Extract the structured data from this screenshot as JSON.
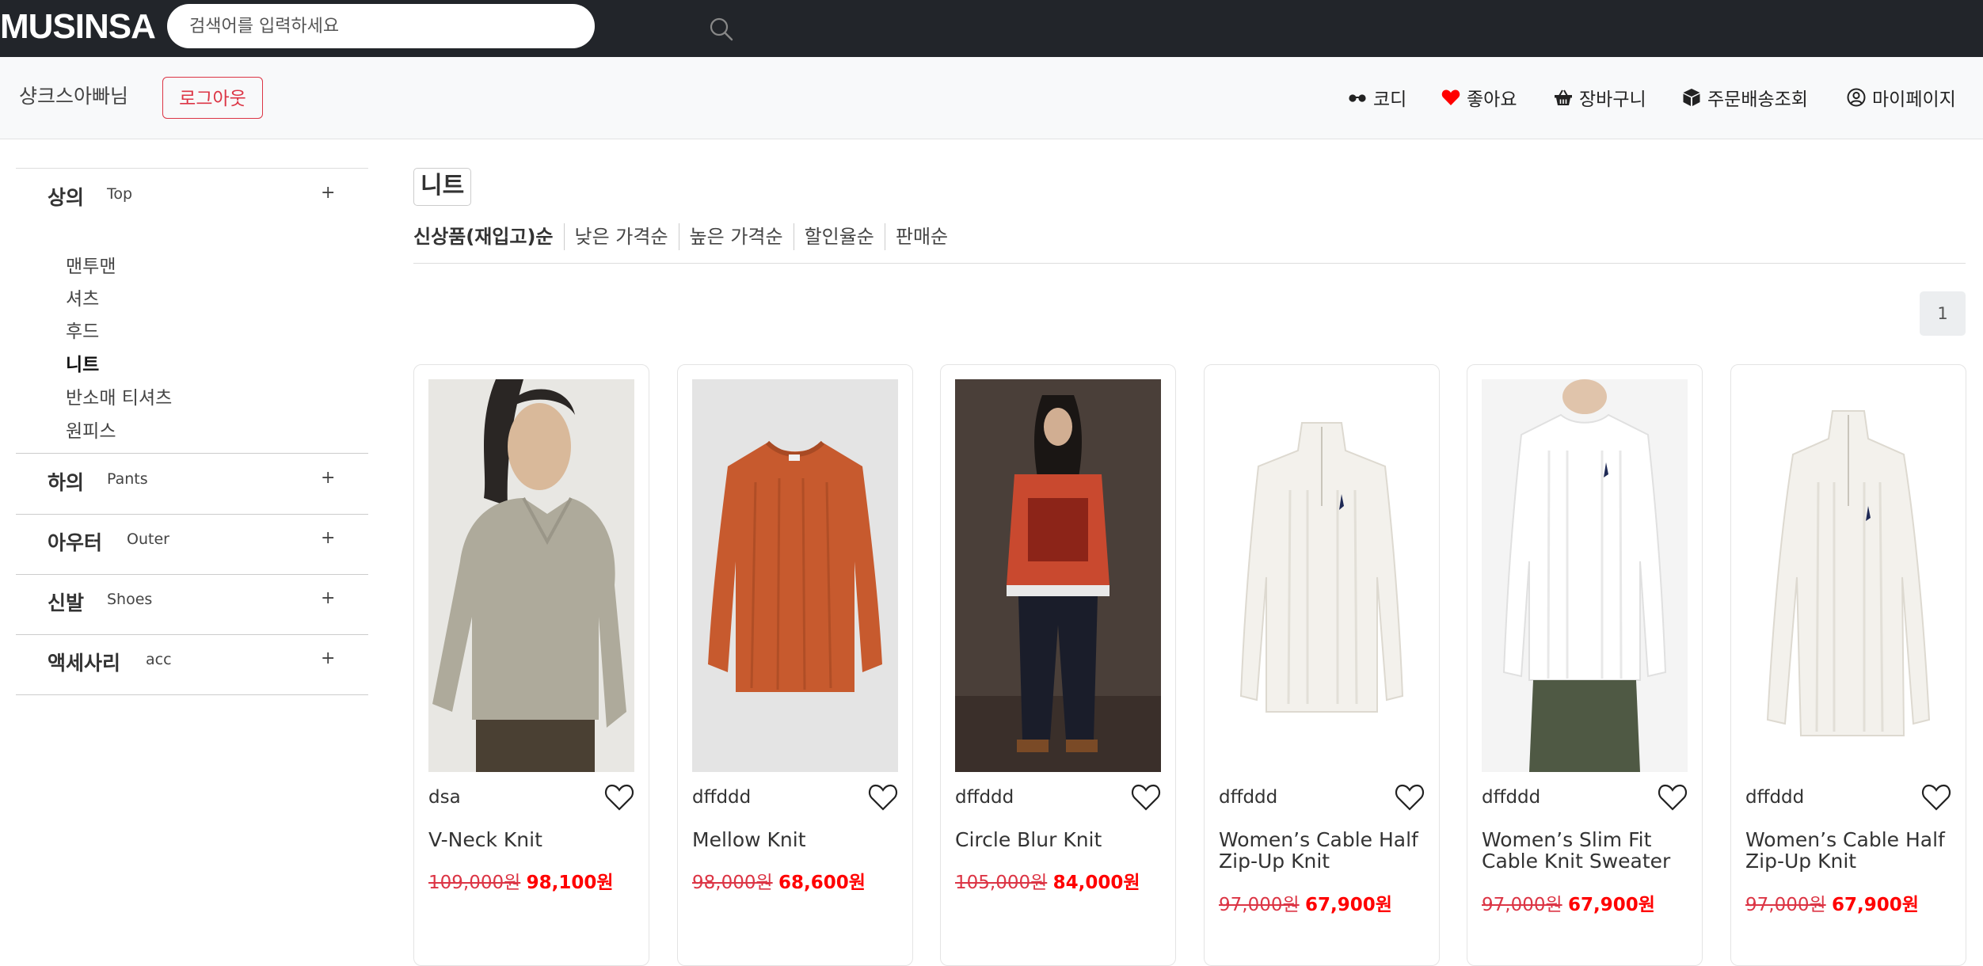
{
  "app": {
    "logo": "MUSINSA"
  },
  "search": {
    "placeholder": "검색어를 입력하세요",
    "icon": "search-icon"
  },
  "user": {
    "name": "샹크스아빠님",
    "logout_label": "로그아웃"
  },
  "nav": [
    {
      "label": "코디",
      "icon": "glasses-icon"
    },
    {
      "label": "좋아요",
      "icon": "heart-icon",
      "color": "#ff0000"
    },
    {
      "label": "장바구니",
      "icon": "basket-icon"
    },
    {
      "label": "주문배송조회",
      "icon": "box-icon"
    },
    {
      "label": "마이페이지",
      "icon": "user-circle-icon"
    }
  ],
  "sidebar": {
    "categories": [
      {
        "kr": "상의",
        "en": "Top",
        "toggle": "+",
        "expanded": true
      },
      {
        "kr": "하의",
        "en": "Pants",
        "toggle": "+"
      },
      {
        "kr": "아우터",
        "en": "Outer",
        "toggle": "+"
      },
      {
        "kr": "신발",
        "en": "Shoes",
        "toggle": "+"
      },
      {
        "kr": "액세사리",
        "en": "acc",
        "toggle": "+"
      }
    ],
    "sub_items": [
      "맨투맨",
      "셔츠",
      "후드",
      "니트",
      "반소매 티셔츠",
      "원피스"
    ],
    "active_sub": "니트"
  },
  "main": {
    "category_title": "니트",
    "sorts": [
      "신상품(재입고)순",
      "낮은 가격순",
      "높은 가격순",
      "할인율순",
      "판매순"
    ],
    "active_sort": "신상품(재입고)순",
    "page": "1"
  },
  "products": [
    {
      "brand": "dsa",
      "name": "V-Neck Knit",
      "original_price": "109,000원",
      "sale_price": "98,100원"
    },
    {
      "brand": "dffddd",
      "name": "Mellow Knit",
      "original_price": "98,000원",
      "sale_price": "68,600원"
    },
    {
      "brand": "dffddd",
      "name": "Circle Blur Knit",
      "original_price": "105,000원",
      "sale_price": "84,000원"
    },
    {
      "brand": "dffddd",
      "name": "Women’s Cable Half Zip-Up Knit",
      "original_price": "97,000원",
      "sale_price": "67,900원"
    },
    {
      "brand": "dffddd",
      "name": "Women’s Slim Fit Cable Knit Sweater",
      "original_price": "97,000원",
      "sale_price": "67,900원"
    },
    {
      "brand": "dffddd",
      "name": "Women’s Cable Half Zip-Up Knit",
      "original_price": "97,000원",
      "sale_price": "67,900원"
    }
  ],
  "colors": {
    "topbar": "#22252a",
    "accent_red": "#dc3545",
    "sale_red": "#ff0000"
  }
}
